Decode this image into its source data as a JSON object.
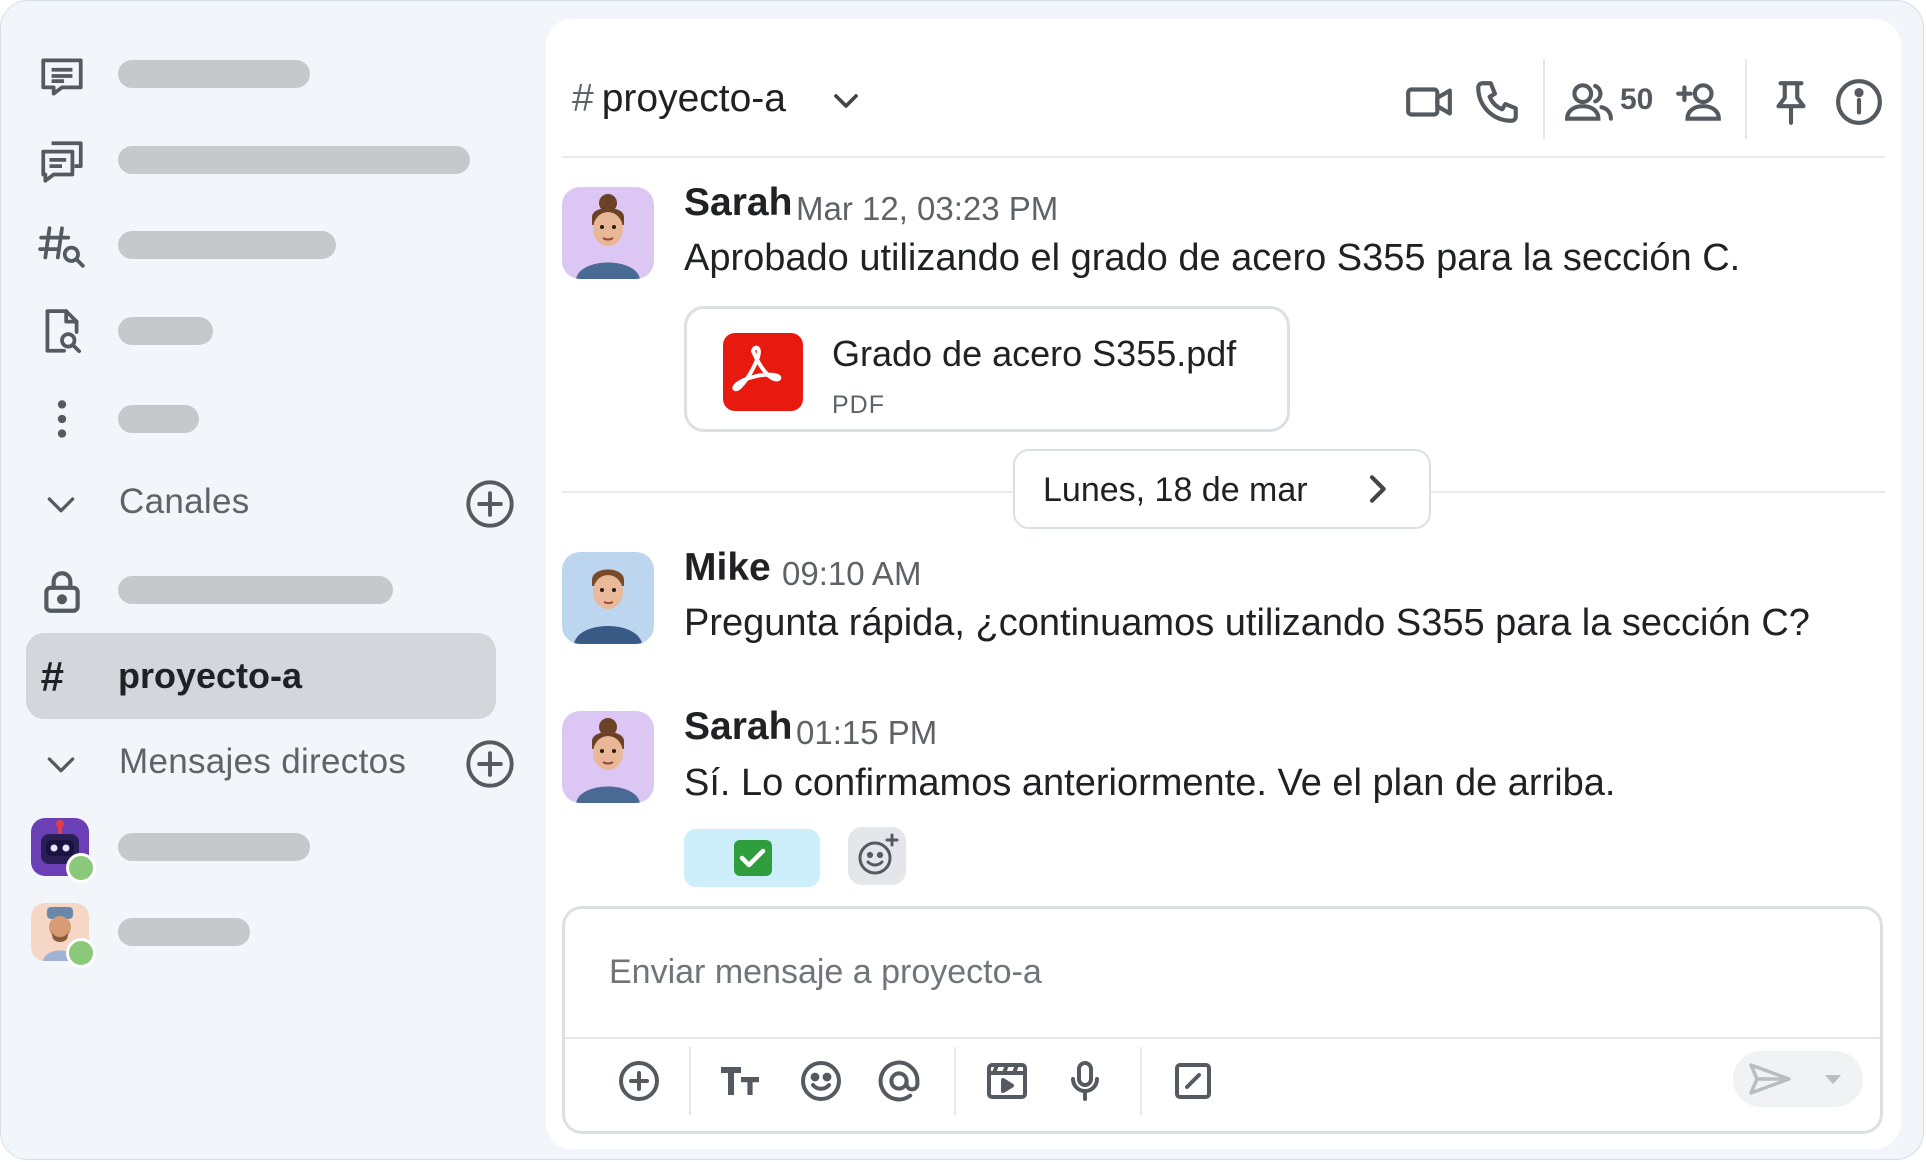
{
  "sidebar": {
    "nav_items": [
      {
        "icon": "inbox-icon"
      },
      {
        "icon": "threads-icon"
      },
      {
        "icon": "browse-channels-icon"
      },
      {
        "icon": "files-search-icon"
      },
      {
        "icon": "more-vertical-icon"
      }
    ],
    "channels_section": {
      "label": "Canales"
    },
    "active_channel": {
      "label": "proyecto-a",
      "hash": "#"
    },
    "dm_section": {
      "label": "Mensajes directos"
    }
  },
  "channel": {
    "hash": "#",
    "name": "proyecto-a",
    "member_count": "50"
  },
  "messages": [
    {
      "author": "Sarah",
      "time": "Mar 12, 03:23 PM",
      "text": "Aprobado utilizando el grado de acero S355 para la sección C.",
      "attachment": {
        "name": "Grado de acero S355.pdf",
        "type": "PDF"
      }
    },
    {
      "author": "Mike",
      "time": "09:10 AM",
      "text": "Pregunta rápida, ¿continuamos utilizando S355 para la sección C?"
    },
    {
      "author": "Sarah",
      "time": "01:15 PM",
      "text": "Sí. Lo confirmamos anteriormente. Ve el plan de arriba.",
      "reaction": "✅"
    }
  ],
  "date_divider": {
    "label": "Lunes, 18 de mar"
  },
  "composer": {
    "placeholder": "Enviar mensaje a proyecto-a"
  },
  "colors": {
    "sidebar_bg": "#f2f5f9",
    "active_channel_bg": "#d3d6da",
    "pdf_red": "#e8190f",
    "reaction_bg": "#cdeefb",
    "online_green": "#8bc97a"
  }
}
